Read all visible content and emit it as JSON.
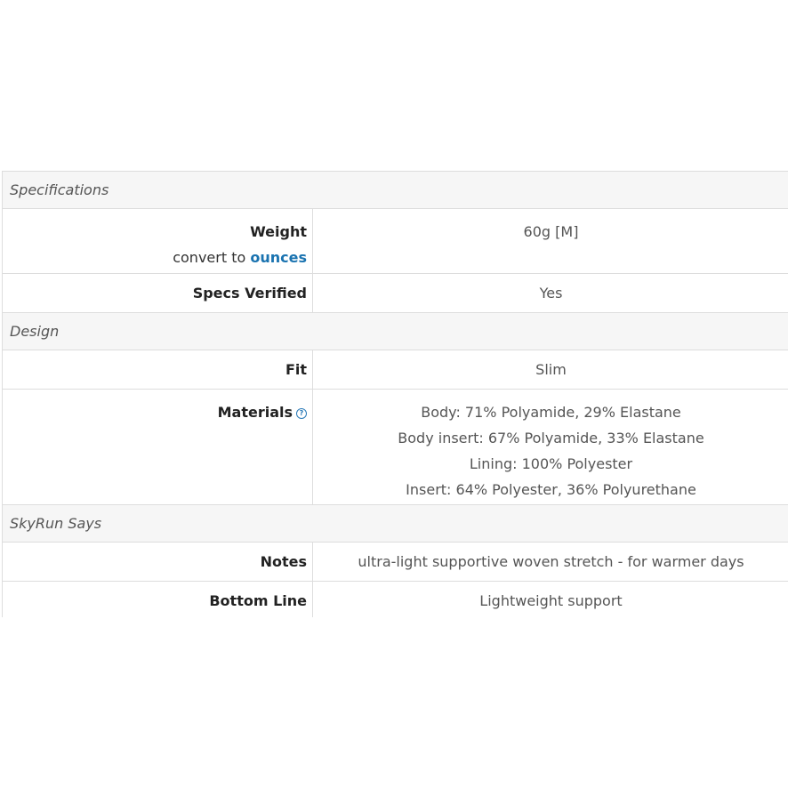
{
  "sections": {
    "specifications": "Specifications",
    "design": "Design",
    "skyrun": "SkyRun Says"
  },
  "rows": {
    "weight": {
      "label": "Weight",
      "convert_prefix": "convert to",
      "convert_link": "ounces",
      "value": "60g [M]"
    },
    "specs_verified": {
      "label": "Specs Verified",
      "value": "Yes"
    },
    "fit": {
      "label": "Fit",
      "value": "Slim"
    },
    "materials": {
      "label": "Materials",
      "help_icon": "?",
      "values": [
        "Body: 71% Polyamide, 29% Elastane",
        "Body insert: 67% Polyamide, 33% Elastane",
        "Lining: 100% Polyester",
        "Insert: 64% Polyester, 36% Polyurethane"
      ]
    },
    "notes": {
      "label": "Notes",
      "value": "ultra-light supportive woven stretch - for warmer days"
    },
    "bottom_line": {
      "label": "Bottom Line",
      "value": "Lightweight support"
    }
  },
  "colors": {
    "link": "#1a73b0",
    "border": "#dddddd",
    "section_bg": "#f6f6f6"
  }
}
